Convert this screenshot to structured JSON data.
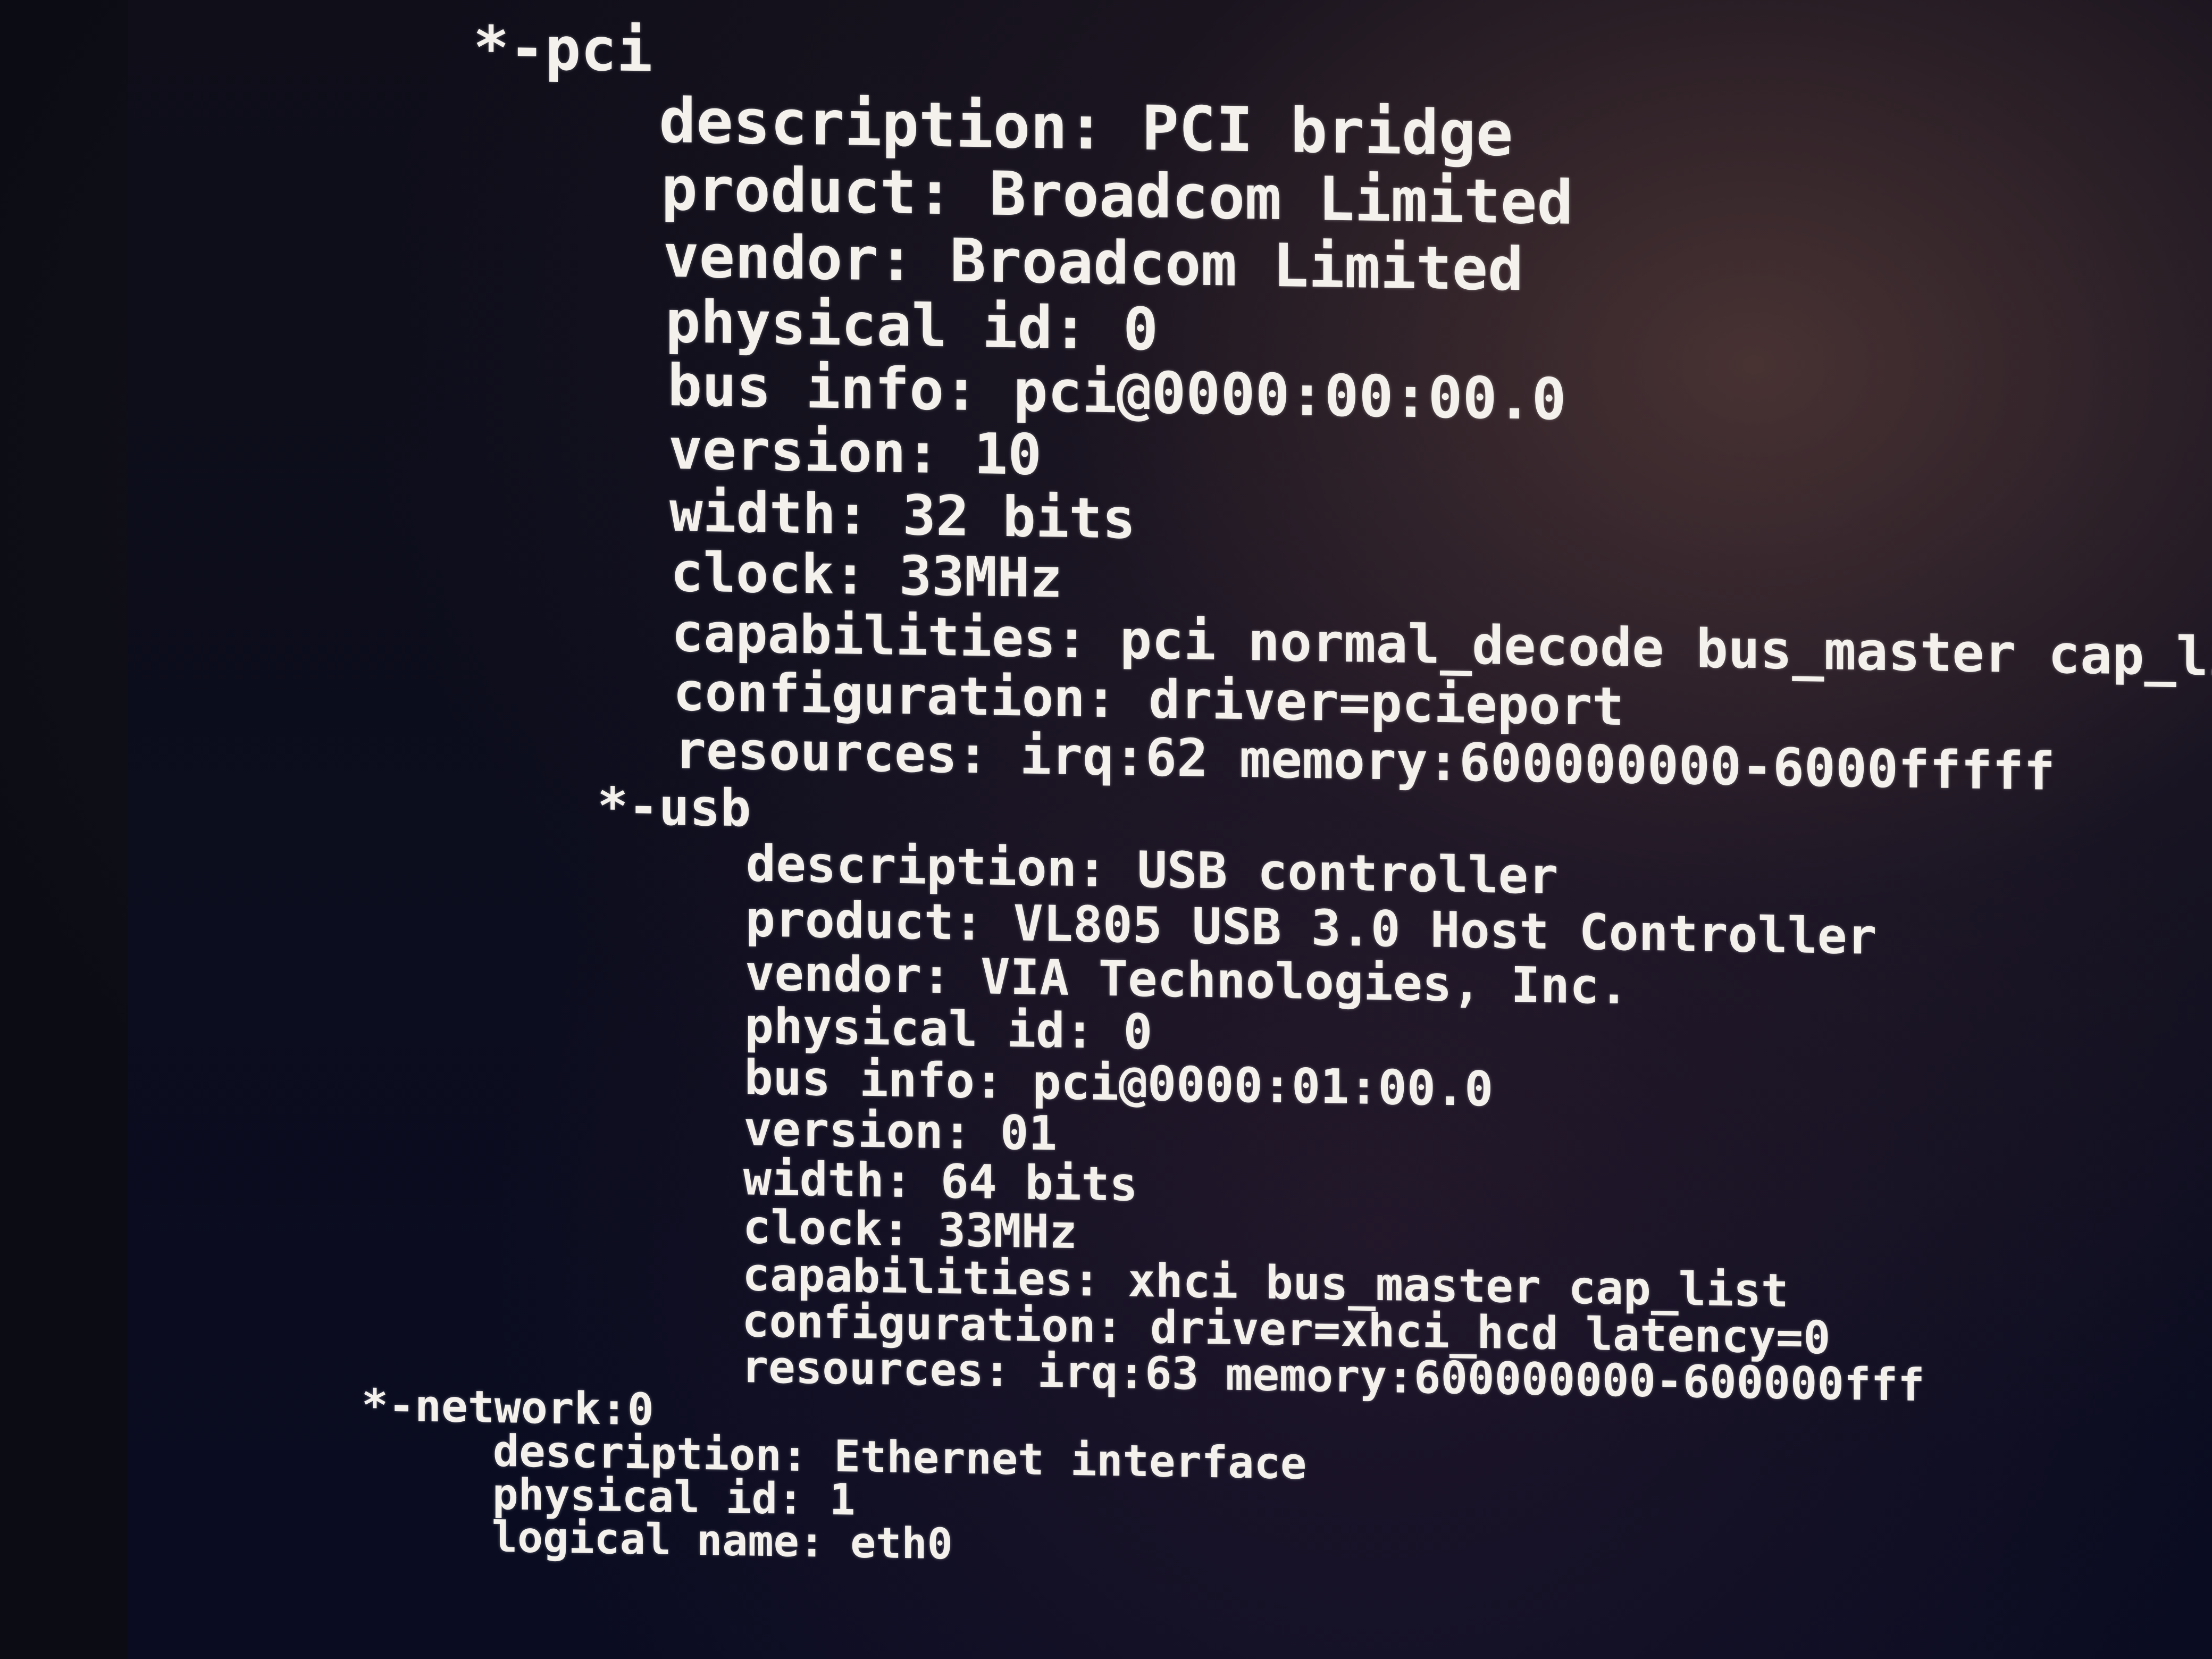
{
  "terminal": {
    "lines": [
      "*-pci",
      "     description: PCI bridge",
      "     product: Broadcom Limited",
      "     vendor: Broadcom Limited",
      "     physical id: 0",
      "     bus info: pci@0000:00:00.0",
      "     version: 10",
      "     width: 32 bits",
      "     clock: 33MHz",
      "     capabilities: pci normal_decode bus_master cap_li",
      "     configuration: driver=pcieport",
      "     resources: irq:62 memory:600000000-6000fffff",
      "   *-usb",
      "        description: USB controller",
      "        product: VL805 USB 3.0 Host Controller",
      "        vendor: VIA Technologies, Inc.",
      "        physical id: 0",
      "        bus info: pci@0000:01:00.0",
      "        version: 01",
      "        width: 64 bits",
      "        clock: 33MHz",
      "        capabilities: xhci bus_master cap_list",
      "        configuration: driver=xhci_hcd latency=0",
      "        resources: irq:63 memory:600000000-600000fff",
      "*-network:0",
      "     description: Ethernet interface",
      "     physical id: 1",
      "     logical name: eth0"
    ]
  }
}
